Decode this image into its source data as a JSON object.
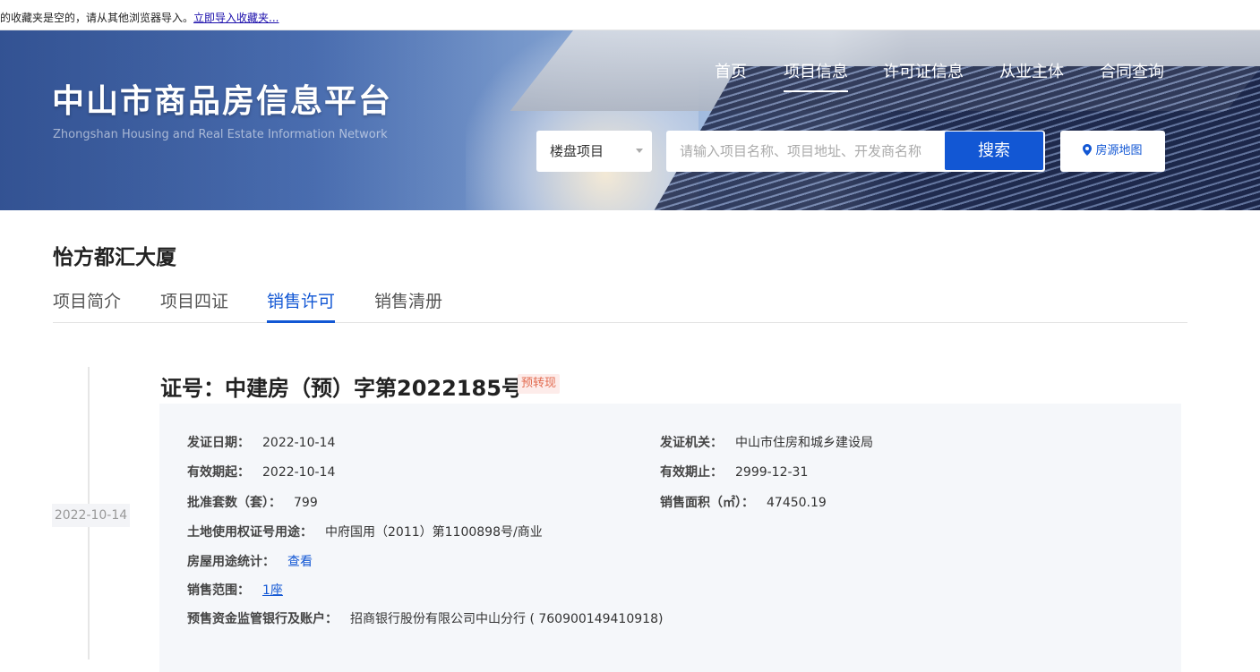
{
  "bookmark_bar": {
    "message": "的收藏夹是空的，请从其他浏览器导入。",
    "import_link": "立即导入收藏夹..."
  },
  "header": {
    "site_title": "中山市商品房信息平台",
    "site_subtitle": "Zhongshan Housing and Real Estate Information Network",
    "nav": [
      {
        "label": "首页"
      },
      {
        "label": "项目信息",
        "active": true
      },
      {
        "label": "许可证信息"
      },
      {
        "label": "从业主体"
      },
      {
        "label": "合同查询"
      }
    ],
    "search": {
      "type_selected": "楼盘项目",
      "placeholder": "请输入项目名称、项目地址、开发商名称",
      "button": "搜索",
      "map_button": "房源地图"
    }
  },
  "project": {
    "name": "怡方都汇大厦",
    "tabs": [
      {
        "label": "项目简介"
      },
      {
        "label": "项目四证"
      },
      {
        "label": "销售许可",
        "active": true
      },
      {
        "label": "销售清册"
      }
    ]
  },
  "permit": {
    "timeline_date": "2022-10-14",
    "title": "证号：中建房（预）字第2022185号",
    "badge": "预转现",
    "fields": {
      "issue_date": {
        "label": "发证日期：",
        "value": "2022-10-14"
      },
      "issuer": {
        "label": "发证机关：",
        "value": "中山市住房和城乡建设局"
      },
      "valid_from": {
        "label": "有效期起：",
        "value": "2022-10-14"
      },
      "valid_to": {
        "label": "有效期止：",
        "value": "2999-12-31"
      },
      "approved_units": {
        "label": "批准套数（套）：",
        "value": "799"
      },
      "sale_area": {
        "label": "销售面积（㎡）：",
        "value": "47450.19"
      },
      "land_cert": {
        "label": "土地使用权证号用途：",
        "value": "中府国用（2011）第1100898号/商业"
      },
      "usage_stats": {
        "label": "房屋用途统计：",
        "value": "查看"
      },
      "sale_scope": {
        "label": "销售范围：",
        "value": "1座"
      },
      "bank": {
        "label": "预售资金监管银行及账户：",
        "value": "招商银行股份有限公司中山分行 ( 760900149410918)"
      }
    }
  },
  "colors": {
    "accent": "#1257d4",
    "badge_bg": "#fdecea",
    "badge_text": "#e26a4e",
    "panel_bg": "#f5f7fa"
  }
}
